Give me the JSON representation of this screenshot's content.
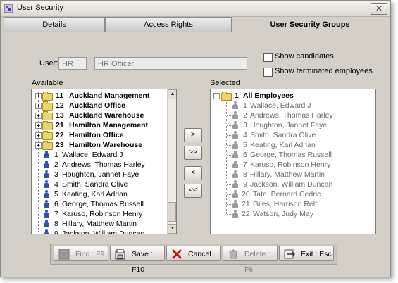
{
  "window": {
    "title": "User Security",
    "close_glyph": "✕"
  },
  "tabs": [
    {
      "label": "Details",
      "active": false
    },
    {
      "label": "Access Rights",
      "active": false
    },
    {
      "label": "User Security Groups",
      "active": true
    }
  ],
  "user": {
    "label": "User:",
    "code": "HR",
    "name": "HR Officer"
  },
  "options": {
    "show_candidates": {
      "label": "Show candidates",
      "checked": false
    },
    "show_terminated": {
      "label": "Show terminated employees",
      "checked": false
    }
  },
  "available": {
    "label": "Available",
    "groups": [
      {
        "code": "11",
        "name": "Auckland Management"
      },
      {
        "code": "12",
        "name": "Auckland Office"
      },
      {
        "code": "13",
        "name": "Auckland Warehouse"
      },
      {
        "code": "21",
        "name": "Hamilton Management"
      },
      {
        "code": "22",
        "name": "Hamilton Office"
      },
      {
        "code": "23",
        "name": "Hamilton Warehouse"
      }
    ],
    "people": [
      {
        "id": "1",
        "name": "Wallace, Edward J"
      },
      {
        "id": "2",
        "name": "Andrews, Thomas Harley"
      },
      {
        "id": "3",
        "name": "Houghton, Jannet Faye"
      },
      {
        "id": "4",
        "name": "Smith, Sandra Olive"
      },
      {
        "id": "5",
        "name": "Keating, Karl Adrian"
      },
      {
        "id": "6",
        "name": "George, Thomas Russell"
      },
      {
        "id": "7",
        "name": "Karuso, Robinson Henry"
      },
      {
        "id": "8",
        "name": "Hillary, Matthew Martin"
      },
      {
        "id": "9",
        "name": "Jackson, William Duncan"
      }
    ]
  },
  "selected": {
    "label": "Selected",
    "group": {
      "code": "1",
      "name": "All Employees"
    },
    "people": [
      {
        "id": "1",
        "name": "Wallace, Edward J"
      },
      {
        "id": "2",
        "name": "Andrews, Thomas Harley"
      },
      {
        "id": "3",
        "name": "Houghton, Jannet Faye"
      },
      {
        "id": "4",
        "name": "Smith, Sandra Olive"
      },
      {
        "id": "5",
        "name": "Keating, Karl Adrian"
      },
      {
        "id": "6",
        "name": "George, Thomas Russell"
      },
      {
        "id": "7",
        "name": "Karuso, Robinson Henry"
      },
      {
        "id": "8",
        "name": "Hillary, Matthew Martin"
      },
      {
        "id": "9",
        "name": "Jackson, William Duncan"
      },
      {
        "id": "20",
        "name": "Tate, Bernard Cedric"
      },
      {
        "id": "21",
        "name": "Giles, Harrison Relf"
      },
      {
        "id": "22",
        "name": "Watson, Judy May"
      }
    ]
  },
  "move_buttons": {
    "add": ">",
    "add_all": ">>",
    "remove": "<",
    "remove_all": "<<"
  },
  "toolbar": {
    "find": {
      "label": "Find : F9",
      "enabled": false,
      "icon": "find-icon"
    },
    "save": {
      "label": "Save : F10",
      "enabled": true,
      "icon": "save-icon"
    },
    "cancel": {
      "label": "Cancel",
      "enabled": true,
      "icon": "cancel-icon"
    },
    "delete": {
      "label": "Delete : F6",
      "enabled": false,
      "icon": "delete-icon"
    },
    "exit": {
      "label": "Exit : Esc",
      "enabled": true,
      "icon": "exit-icon"
    }
  },
  "colors": {
    "person_available": "#2c4fb0",
    "person_selected": "#9a9a9a",
    "folder": "#ecd36a",
    "cancel_x": "#cc1111"
  }
}
